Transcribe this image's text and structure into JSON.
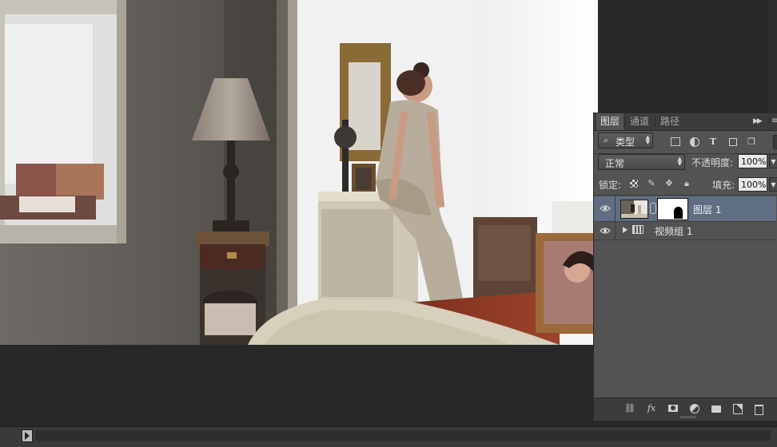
{
  "layers_panel": {
    "tabs": [
      {
        "label": "图层",
        "active": true
      },
      {
        "label": "通道",
        "active": false
      },
      {
        "label": "路径",
        "active": false
      }
    ],
    "filter": {
      "search_icon": "search-icon",
      "label": "类型"
    },
    "blend_mode": "正常",
    "opacity_label": "不透明度:",
    "opacity_value": "100%",
    "lock_label": "锁定:",
    "fill_label": "填充:",
    "fill_value": "100%",
    "layers": [
      {
        "name": "图层 1",
        "selected": true,
        "visible": true,
        "has_mask": true
      },
      {
        "name": "视频组 1",
        "selected": false,
        "visible": true,
        "type": "video-group",
        "collapsed": true
      }
    ],
    "bottom_icons": [
      "link-layers-icon",
      "fx-icon",
      "add-mask-icon",
      "new-adjustment-icon",
      "new-group-icon",
      "new-layer-icon",
      "delete-layer-icon"
    ],
    "fx_label": "fx",
    "selection_color": "#5f6e83"
  },
  "theme": {
    "workspace_bg": "#282828",
    "panel_bg": "#535353"
  }
}
